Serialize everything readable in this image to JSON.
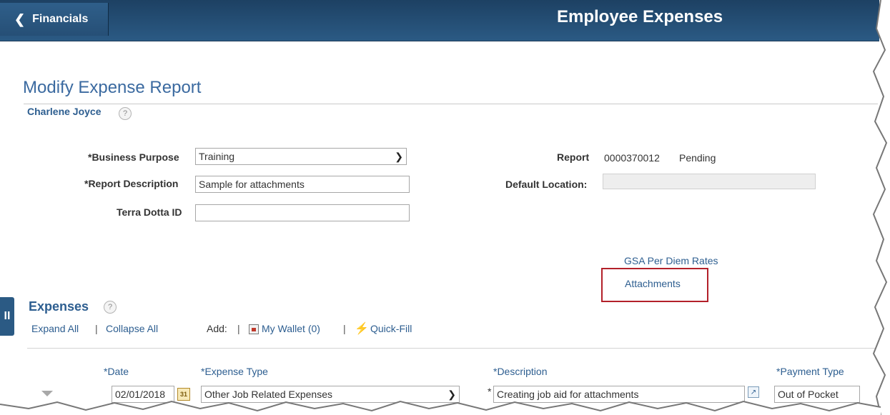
{
  "banner": {
    "back_label": "Financials",
    "title": "Employee Expenses"
  },
  "page": {
    "title": "Modify Expense Report",
    "user_name": "Charlene Joyce",
    "help_glyph": "?"
  },
  "form": {
    "business_purpose_label": "*Business Purpose",
    "business_purpose_value": "Training",
    "report_description_label": "*Report Description",
    "report_description_value": "Sample for attachments",
    "terra_dotta_label": "Terra Dotta ID",
    "terra_dotta_value": "",
    "report_label": "Report",
    "report_id": "0000370012",
    "report_status": "Pending",
    "default_location_label": "Default Location:"
  },
  "links": {
    "gsa_per_diem": "GSA Per Diem Rates",
    "attachments": "Attachments"
  },
  "expenses": {
    "section_title": "Expenses",
    "side_tab_glyph": "II",
    "expand_all": "Expand All",
    "collapse_all": "Collapse All",
    "add_label": "Add:",
    "separator": "|",
    "my_wallet": "My Wallet (0)",
    "quick_fill": "Quick-Fill",
    "columns": {
      "date": "*Date",
      "expense_type": "*Expense Type",
      "description": "*Description",
      "payment_type": "*Payment Type"
    },
    "row": {
      "date": "02/01/2018",
      "expense_type": "Other Job Related Expenses",
      "description": "Creating job aid for attachments",
      "payment_type": "Out of Pocket",
      "required_marker": "*",
      "calendar_glyph": "31",
      "expand_glyph": "↗"
    }
  },
  "colors": {
    "banner": "#2b5a84",
    "link": "#2d5e90",
    "highlight": "#b3202a"
  }
}
